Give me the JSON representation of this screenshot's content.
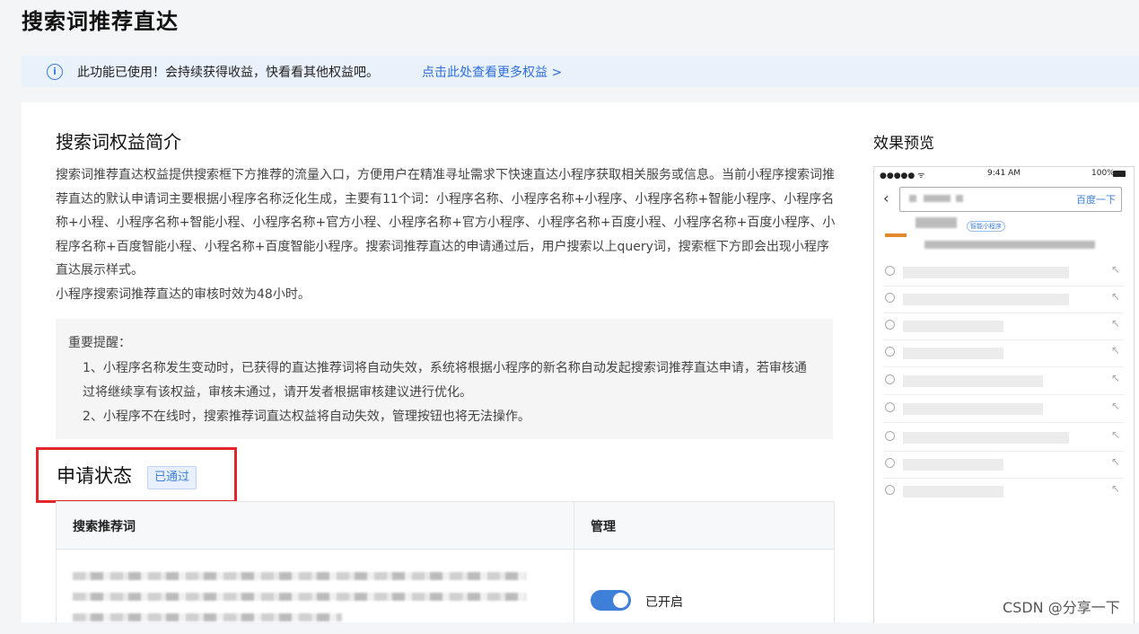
{
  "page": {
    "title": "搜索词推荐直达"
  },
  "notice": {
    "message": "此功能已使用！会持续获得收益，快看看其他权益吧。",
    "link": "点击此处查看更多权益 >"
  },
  "intro": {
    "title": "搜索词权益简介",
    "paragraph1": "搜索词推荐直达权益提供搜索框下方推荐的流量入口，方便用户在精准寻址需求下快速直达小程序获取相关服务或信息。当前小程序搜索词推荐直达的默认申请词主要根据小程序名称泛化生成，主要有11个词：小程序名称、小程序名称+小程序、小程序名称+智能小程序、小程序名称+小程、小程序名称+智能小程、小程序名称+官方小程、小程序名称+官方小程序、小程序名称+百度小程、小程序名称+百度小程序、小程序名称+百度智能小程、小程名称+百度智能小程序。搜索词推荐直达的申请通过后，用户搜索以上query词，搜索框下方即会出现小程序直达展示样式。",
    "paragraph2": "小程序搜索词推荐直达的审核时效为48小时。"
  },
  "reminder": {
    "title": "重要提醒：",
    "items": [
      "1、小程序名称发生变动时，已获得的直达推荐词将自动失效，系统将根据小程序的新名称自动发起搜索词推荐直达申请，若审核通过将继续享有该权益，审核未通过，请开发者根据审核建议进行优化。",
      "2、小程序不在线时，搜索推荐词直达权益将自动失效，管理按钮也将无法操作。"
    ]
  },
  "status": {
    "title": "申请状态",
    "badge": "已通过"
  },
  "table": {
    "headers": [
      "搜索推荐词",
      "管理"
    ],
    "toggle_label": "已开启",
    "toggle_on": true
  },
  "preview": {
    "title": "效果预览",
    "statusbar": {
      "signal": "●●●●● ᯤ",
      "time": "9:41 AM",
      "battery": "100%"
    },
    "search_button": "百度一下",
    "mini_badge": "智能小程序"
  },
  "watermark": "CSDN @分享一下",
  "colors": {
    "accent": "#3d7fd9",
    "highlight_border": "#e3262c",
    "notice_bg": "#e9f1fb"
  }
}
